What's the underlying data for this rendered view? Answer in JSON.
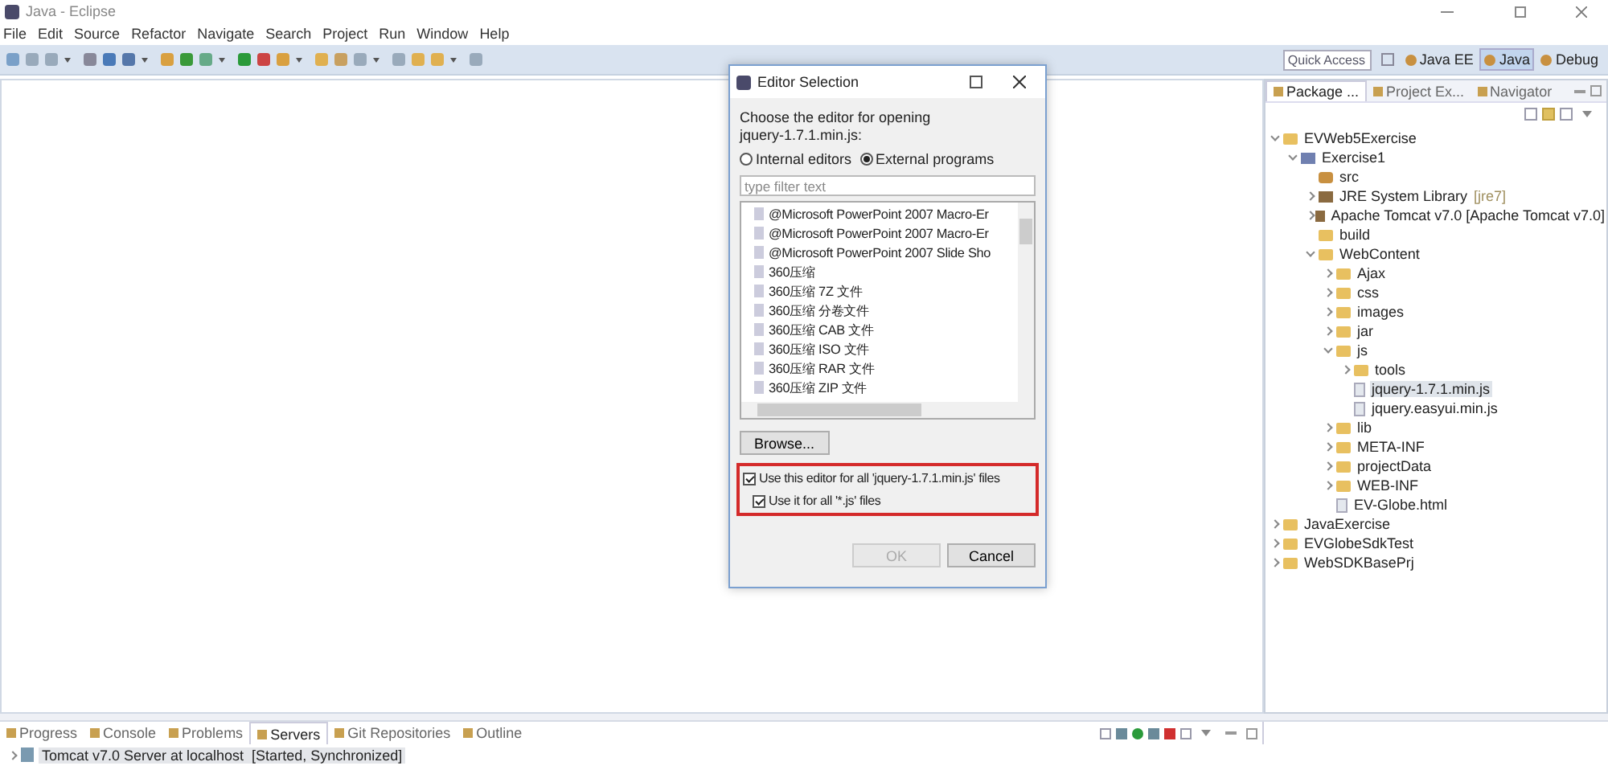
{
  "window": {
    "title": "Java - Eclipse"
  },
  "menu": [
    "File",
    "Edit",
    "Source",
    "Refactor",
    "Navigate",
    "Search",
    "Project",
    "Run",
    "Window",
    "Help"
  ],
  "quick_access": {
    "placeholder": "Quick Access"
  },
  "perspectives": [
    {
      "label": "Java EE",
      "selected": false
    },
    {
      "label": "Java",
      "selected": true
    },
    {
      "label": "Debug",
      "selected": false
    }
  ],
  "dialog": {
    "title": "Editor Selection",
    "prompt": "Choose the editor for opening jquery-1.7.1.min.js:",
    "options": [
      {
        "label": "Internal editors",
        "selected": false
      },
      {
        "label": "External programs",
        "selected": true
      }
    ],
    "filter": {
      "placeholder": "type filter text"
    },
    "programs": [
      "@Microsoft PowerPoint 2007 Macro-Er",
      "@Microsoft PowerPoint 2007 Macro-Er",
      "@Microsoft PowerPoint 2007 Slide Sho",
      "360压缩",
      "360压缩 7Z 文件",
      "360压缩 分卷文件",
      "360压缩 CAB 文件",
      "360压缩 ISO 文件",
      "360压缩 RAR 文件",
      "360压缩 ZIP 文件"
    ],
    "browse": "Browse...",
    "checks": [
      {
        "label": "Use this editor for all 'jquery-1.7.1.min.js' files",
        "checked": true
      },
      {
        "label": "Use it for all '*.js' files",
        "checked": true
      }
    ],
    "buttons": [
      {
        "label": "OK",
        "disabled": true
      },
      {
        "label": "Cancel",
        "disabled": false
      }
    ]
  },
  "explorer": {
    "tabs": [
      {
        "label": "Package ...",
        "selected": true
      },
      {
        "label": "Project Ex...",
        "selected": false
      },
      {
        "label": "Navigator",
        "selected": false
      }
    ],
    "tree": [
      {
        "label": "EVWeb5Exercise",
        "kind": "project",
        "expanded": true,
        "selected": false,
        "children": [
          {
            "label": "Exercise1",
            "kind": "module",
            "expanded": true,
            "selected": false,
            "children": [
              {
                "label": "src",
                "kind": "source",
                "selected": false
              },
              {
                "label": "JRE System Library",
                "decoration": "[jre7]",
                "kind": "library",
                "expanded": false,
                "selected": false
              },
              {
                "label": "Apache Tomcat v7.0 [Apache Tomcat v7.0]",
                "kind": "library",
                "expanded": false,
                "selected": false
              },
              {
                "label": "build",
                "kind": "folder",
                "selected": false
              },
              {
                "label": "WebContent",
                "kind": "folder",
                "expanded": true,
                "selected": false,
                "children": [
                  {
                    "label": "Ajax",
                    "kind": "folder",
                    "expanded": false,
                    "selected": false
                  },
                  {
                    "label": "css",
                    "kind": "folder",
                    "expanded": false,
                    "selected": false
                  },
                  {
                    "label": "images",
                    "kind": "folder",
                    "expanded": false,
                    "selected": false
                  },
                  {
                    "label": "jar",
                    "kind": "folder",
                    "expanded": false,
                    "selected": false
                  },
                  {
                    "label": "js",
                    "kind": "folder",
                    "expanded": true,
                    "selected": false,
                    "children": [
                      {
                        "label": "tools",
                        "kind": "folder",
                        "expanded": false,
                        "selected": false
                      },
                      {
                        "label": "jquery-1.7.1.min.js",
                        "kind": "file",
                        "selected": true
                      },
                      {
                        "label": "jquery.easyui.min.js",
                        "kind": "file",
                        "selected": false
                      }
                    ]
                  },
                  {
                    "label": "lib",
                    "kind": "folder",
                    "expanded": false,
                    "selected": false
                  },
                  {
                    "label": "META-INF",
                    "kind": "folder",
                    "expanded": false,
                    "selected": false
                  },
                  {
                    "label": "projectData",
                    "kind": "folder",
                    "expanded": false,
                    "selected": false
                  },
                  {
                    "label": "WEB-INF",
                    "kind": "folder",
                    "expanded": false,
                    "selected": false
                  },
                  {
                    "label": "EV-Globe.html",
                    "kind": "file",
                    "selected": false
                  }
                ]
              }
            ]
          }
        ]
      },
      {
        "label": "JavaExercise",
        "kind": "project",
        "expanded": false,
        "selected": false
      },
      {
        "label": "EVGlobeSdkTest",
        "kind": "project",
        "expanded": false,
        "selected": false
      },
      {
        "label": "WebSDKBasePrj",
        "kind": "project",
        "expanded": false,
        "selected": false
      }
    ]
  },
  "bottom": {
    "tabs": [
      {
        "label": "Progress",
        "selected": false
      },
      {
        "label": "Console",
        "selected": false
      },
      {
        "label": "Problems",
        "selected": false
      },
      {
        "label": "Servers",
        "selected": true
      },
      {
        "label": "Git Repositories",
        "selected": false
      },
      {
        "label": "Outline",
        "selected": false
      }
    ],
    "servers": [
      {
        "name": "Tomcat v7.0 Server at localhost",
        "state": "[Started, Synchronized]",
        "selected": true
      }
    ]
  }
}
